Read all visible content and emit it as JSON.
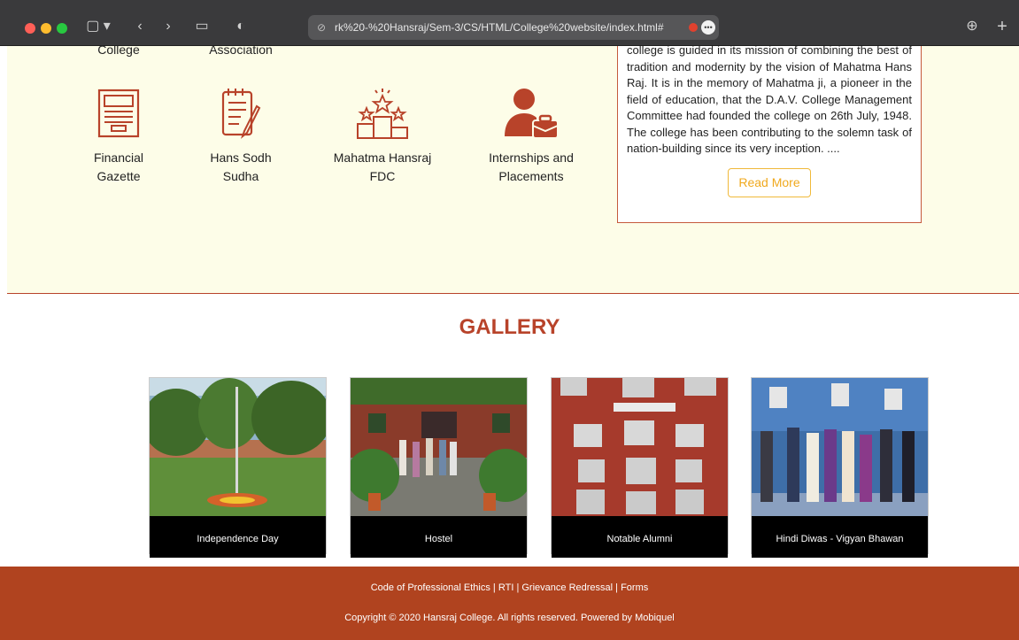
{
  "browser": {
    "url": "rk%20-%20Hansraj/Sem-3/CS/HTML/College%20website/index.html#"
  },
  "top_cutoff_labels": [
    "College",
    "Association"
  ],
  "quick_links": [
    {
      "label_line1": "Financial",
      "label_line2": "Gazette",
      "icon": "newspaper-icon"
    },
    {
      "label_line1": "Hans Sodh",
      "label_line2": "Sudha",
      "icon": "notebook-pen-icon"
    },
    {
      "label_line1": "Mahatma Hansraj",
      "label_line2": "FDC",
      "icon": "podium-stars-icon"
    },
    {
      "label_line1": "Internships and",
      "label_line2": "Placements",
      "icon": "person-briefcase-icon"
    }
  ],
  "about": {
    "text": "college is guided in its mission of combining the best of tradition and modernity by the vision of Mahatma Hans Raj. It is in the memory of Mahatma ji, a pioneer in the field of education, that the D.A.V. College Management Committee had founded the college on 26th July, 1948. The college has been contributing to the solemn task of nation-building since its very inception. ....",
    "button": "Read More"
  },
  "gallery": {
    "title": "GALLERY",
    "items": [
      {
        "caption": "Independence Day"
      },
      {
        "caption": "Hostel"
      },
      {
        "caption": "Notable Alumni"
      },
      {
        "caption": "Hindi Diwas - Vigyan Bhawan"
      }
    ]
  },
  "footer": {
    "link1": "Code of Professional Ethics",
    "link2": "RTI",
    "link3": "Grievance Redressal",
    "link4": "Forms",
    "separator": " | ",
    "copyright": "Copyright © 2020 Hansraj College. All rights reserved. Powered by Mobiquel"
  },
  "colors": {
    "accent": "#b8432a",
    "footer": "#b0431f",
    "section_bg": "#fdfde8",
    "button_border": "#f0b93a"
  }
}
